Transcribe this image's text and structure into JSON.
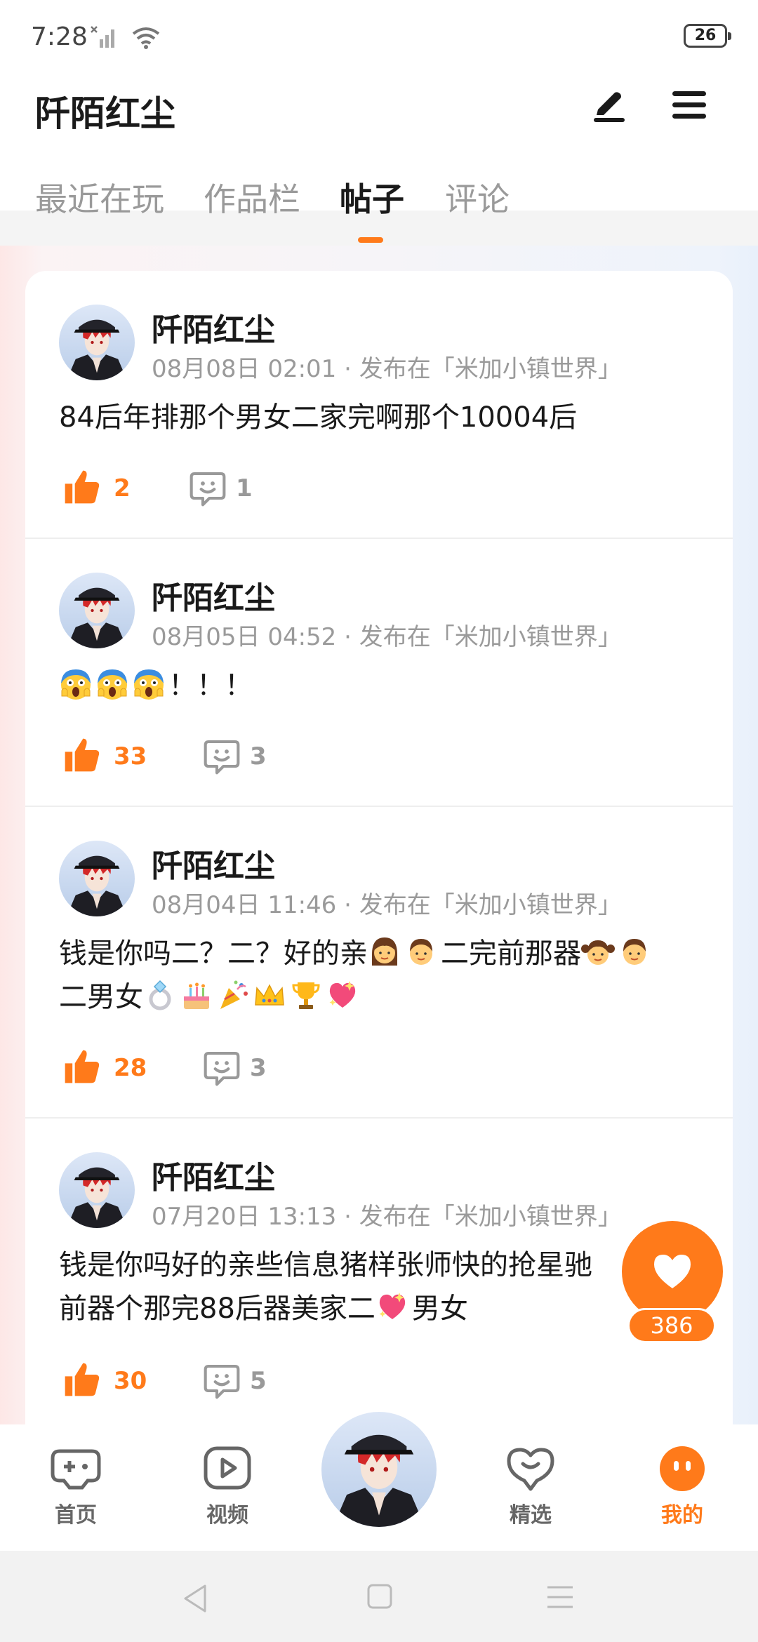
{
  "status_bar": {
    "time": "7:28",
    "battery": "26"
  },
  "header": {
    "title": "阡陌红尘",
    "tabs": [
      "最近在玩",
      "作品栏",
      "帖子",
      "评论"
    ],
    "active_tab": "帖子"
  },
  "posts": [
    {
      "author": "阡陌红尘",
      "meta": "08月08日 02:01 · 发布在「米加小镇世界」",
      "text": "84后年排那个男女二家完啊那个10004后",
      "likes": "2",
      "comments": "1"
    },
    {
      "author": "阡陌红尘",
      "meta": "08月05日 04:52 · 发布在「米加小镇世界」",
      "text": "！！！",
      "likes": "33",
      "comments": "3"
    },
    {
      "author": "阡陌红尘",
      "meta": "08月04日 11:46 · 发布在「米加小镇世界」",
      "text_line1": "钱是你吗二？二？好的亲",
      "text_line1b": "二完前那器",
      "text_line2": "二男女",
      "likes": "28",
      "comments": "3"
    },
    {
      "author": "阡陌红尘",
      "meta": "07月20日 13:13 · 发布在「米加小镇世界」",
      "text_line1": "钱是你吗好的亲些信息猪样张师快的抢星驰",
      "text_line2a": "前器个那完88后器美家二",
      "text_line2b": "男女",
      "likes": "30",
      "comments": "5"
    }
  ],
  "floating_like": {
    "count": "386"
  },
  "bottom_nav": {
    "items": [
      {
        "label": "首页",
        "icon": "gamepad-icon"
      },
      {
        "label": "视频",
        "icon": "video-play-icon"
      },
      {
        "label": "精选",
        "icon": "heart-chat-icon"
      },
      {
        "label": "我的",
        "icon": "face-icon"
      }
    ],
    "active": "我的"
  },
  "colors": {
    "accent": "#ff7a1a",
    "muted": "#9a9a9a"
  }
}
